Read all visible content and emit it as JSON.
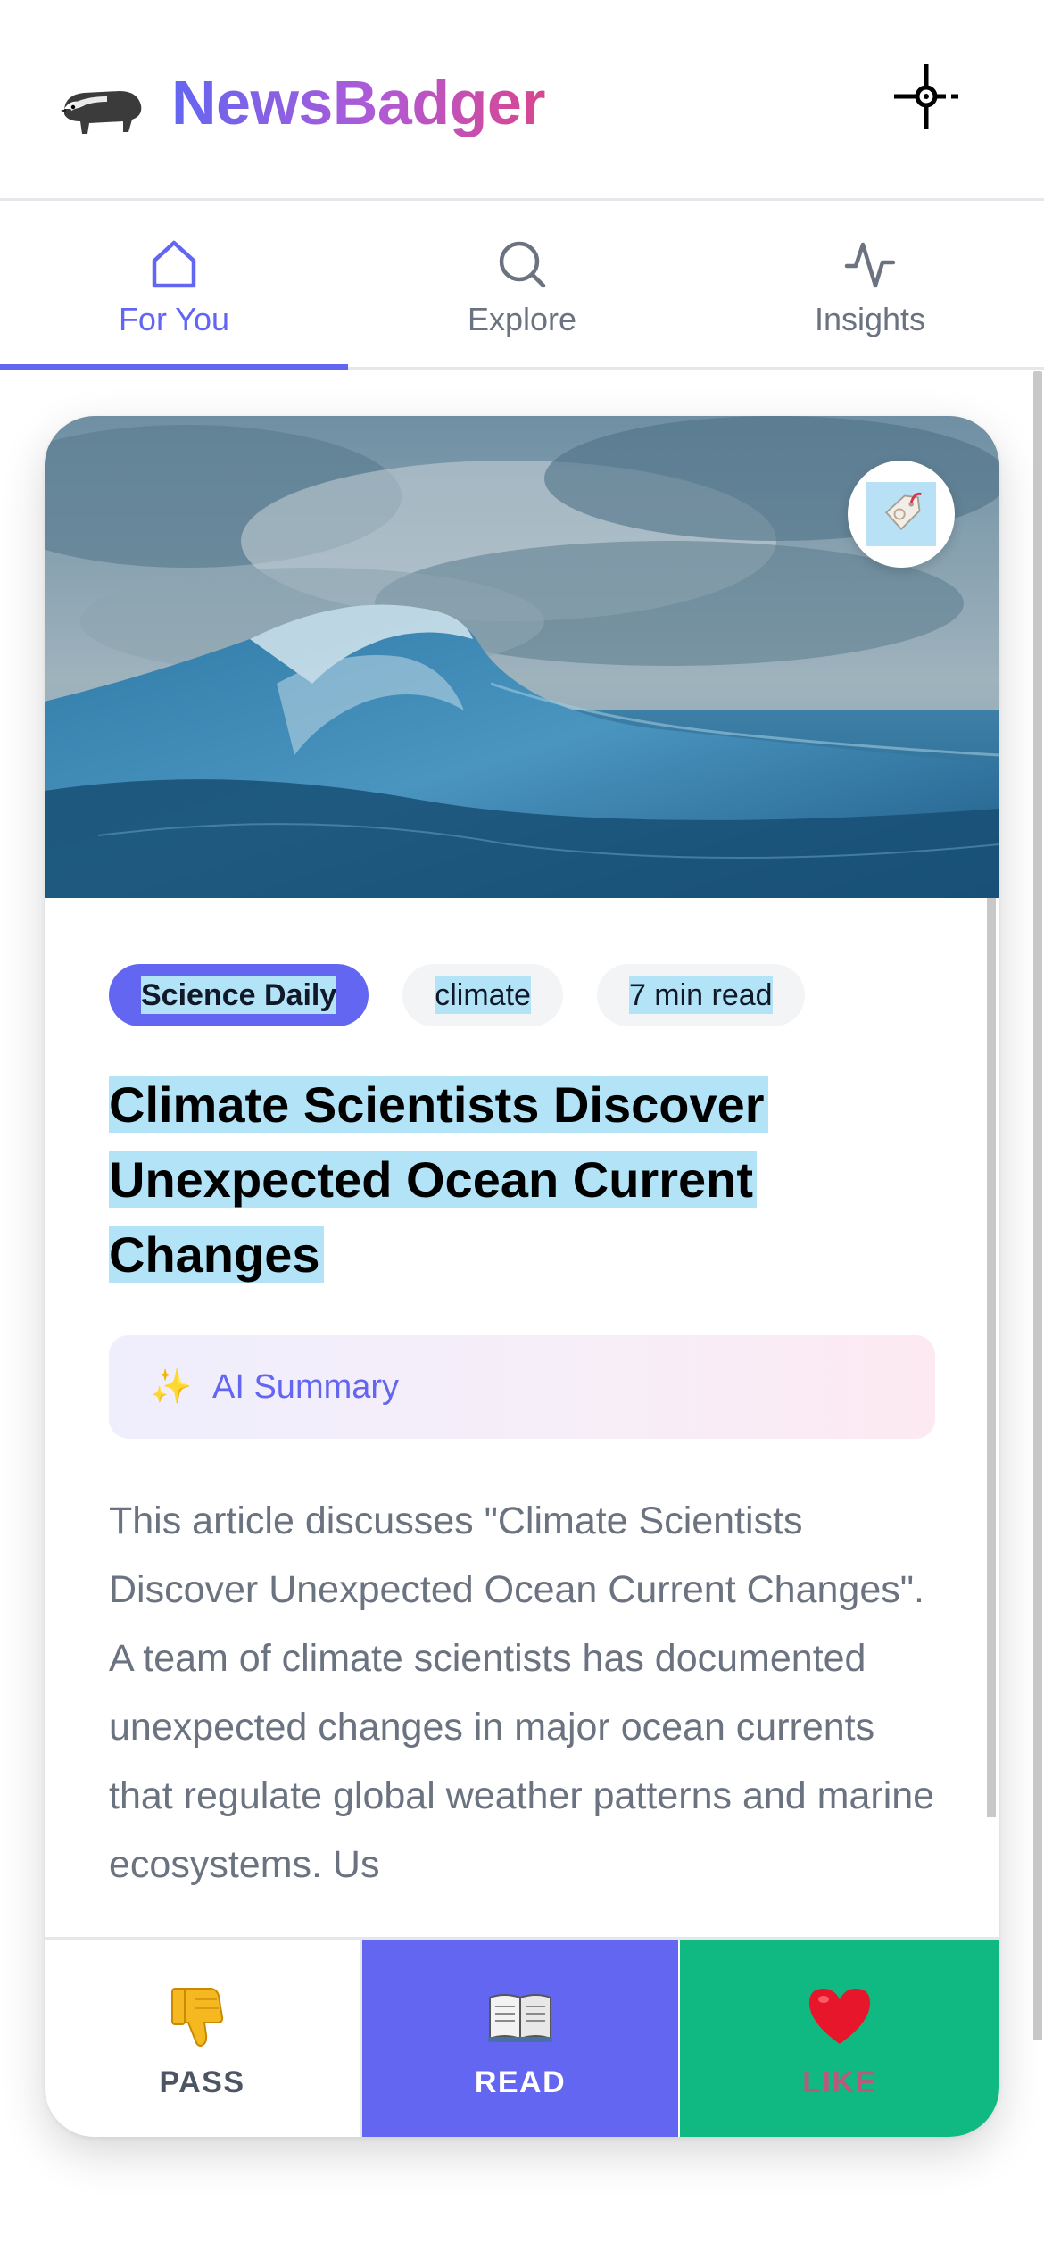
{
  "header": {
    "app_name": "NewsBadger",
    "logo_icon": "badger-icon",
    "action_icon": "crosshair-icon"
  },
  "tabs": [
    {
      "label": "For You",
      "icon": "home-icon",
      "active": true
    },
    {
      "label": "Explore",
      "icon": "search-icon",
      "active": false
    },
    {
      "label": "Insights",
      "icon": "activity-icon",
      "active": false
    }
  ],
  "article": {
    "hero_image": "ocean-wave",
    "bookmark_icon": "tag-icon",
    "source": "Science Daily",
    "topic": "climate",
    "read_time": "7 min read",
    "title_lines": [
      "Climate Scientists Discover",
      "Unexpected Ocean Current",
      "Changes"
    ],
    "ai_summary_label": "AI Summary",
    "ai_summary_icon": "sparkles-icon",
    "summary": "This article discusses \"Climate Scientists Discover Unexpected Ocean Current Changes\". A team of climate scientists has documented unexpected changes in major ocean currents that regulate global weather patterns and marine ecosystems. Us"
  },
  "actions": {
    "pass_label": "PASS",
    "pass_icon": "thumbs-down-icon",
    "read_label": "READ",
    "read_icon": "open-book-icon",
    "like_label": "LIKE",
    "like_icon": "heart-icon"
  },
  "colors": {
    "accent": "#6366f1",
    "like": "#10b981",
    "brand_gradient_end": "#d9468f",
    "highlight": "#b3e3f6"
  }
}
